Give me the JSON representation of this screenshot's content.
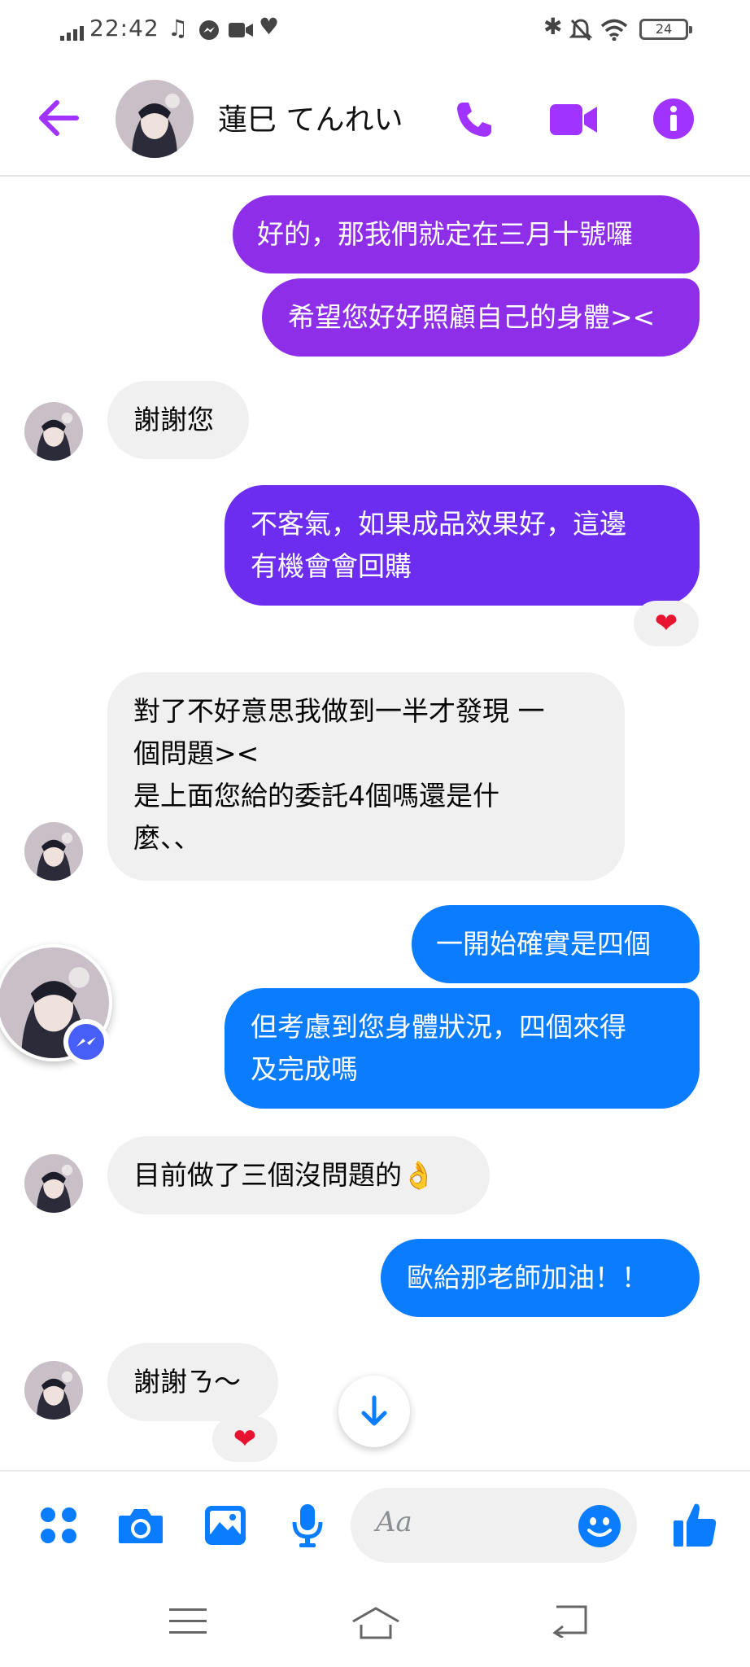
{
  "status_bar": {
    "time": "22:42",
    "battery": "24"
  },
  "header": {
    "contact_name": "蓮巳 てんれい",
    "icons": [
      "back-arrow-icon",
      "phone-icon",
      "video-camera-icon",
      "info-icon"
    ]
  },
  "messages": [
    {
      "side": "out",
      "color": "#8e2ee9",
      "lines": [
        "好的，那我們就定在三月十號囉"
      ]
    },
    {
      "side": "out",
      "color": "#8e2ee9",
      "lines": [
        "希望您好好照顧自己的身體><"
      ]
    },
    {
      "side": "in",
      "lines": [
        "謝謝您"
      ]
    },
    {
      "side": "out",
      "color": "#6c2df0",
      "lines": [
        "不客氣，如果成品效果好，這邊",
        "有機會會回購"
      ],
      "reaction": "❤"
    },
    {
      "side": "in",
      "lines": [
        "對了不好意思我做到一半才發現 一",
        "個問題><",
        "是上面您給的委託4個嗎還是什",
        "麼、、"
      ]
    },
    {
      "side": "out",
      "color": "#0a7cff",
      "lines": [
        "一開始確實是四個"
      ]
    },
    {
      "side": "out",
      "color": "#0a7cff",
      "lines": [
        "但考慮到您身體狀況，四個來得",
        "及完成嗎"
      ]
    },
    {
      "side": "in",
      "lines": [
        "目前做了三個沒問題的👌"
      ]
    },
    {
      "side": "out",
      "color": "#0a7cff",
      "lines": [
        "歐給那老師加油！！"
      ]
    },
    {
      "side": "in",
      "lines": [
        "謝謝ㄋ～"
      ],
      "reaction": "❤"
    }
  ],
  "composer": {
    "placeholder": "Aa",
    "icons": [
      "apps-icon",
      "camera-icon",
      "gallery-icon",
      "microphone-icon",
      "emoji-icon",
      "thumbs-up-icon"
    ]
  },
  "nav_bar": {
    "icons": [
      "menu-icon",
      "home-icon",
      "back-icon"
    ]
  },
  "colors": {
    "accent": "#a033ff",
    "bubble_purple": "#8e2ee9",
    "bubble_violet": "#6c2df0",
    "bubble_blue": "#0a7cff",
    "bubble_incoming": "#f0f0f0",
    "composer_icons": "#0a7cff"
  }
}
